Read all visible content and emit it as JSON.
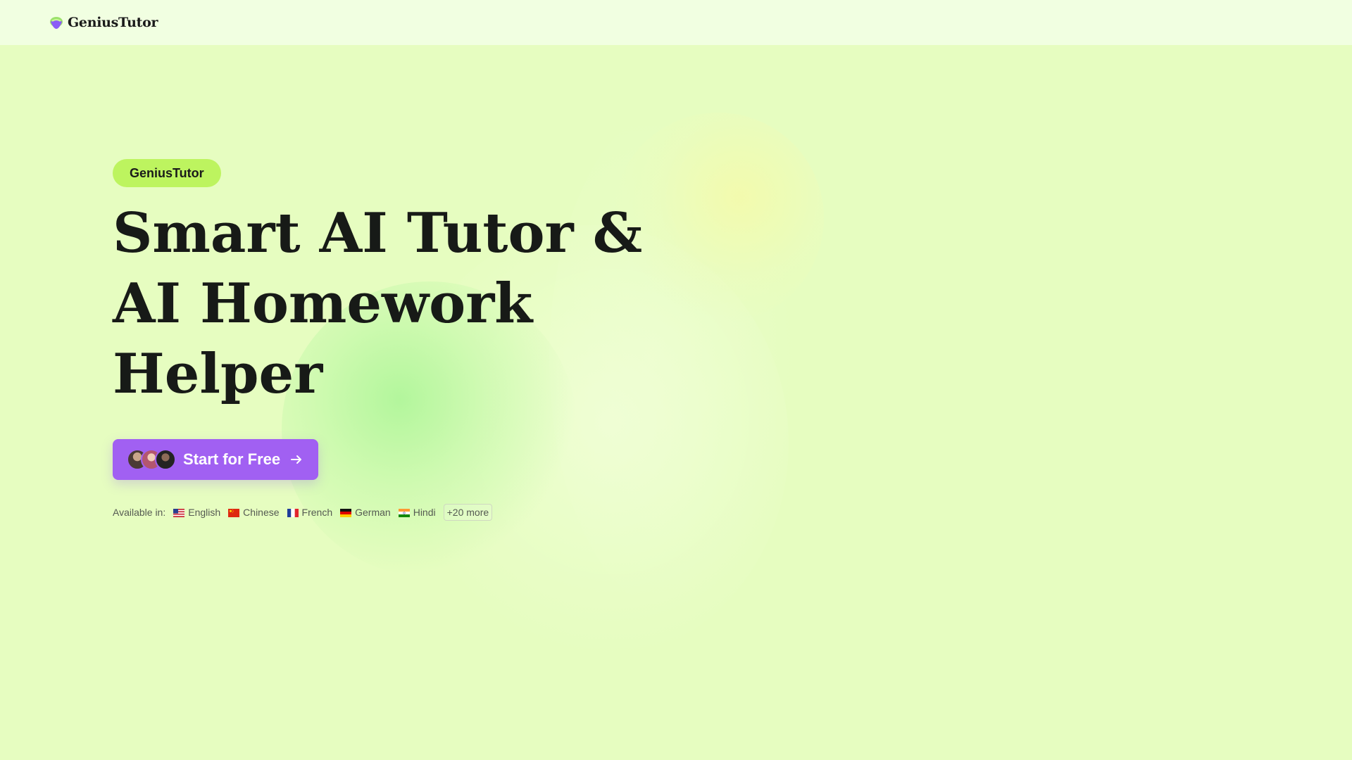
{
  "header": {
    "brand": "GeniusTutor",
    "logo_icon": "geniustutor-logo-icon"
  },
  "hero": {
    "badge": "GeniusTutor",
    "headline_lines": [
      "Smart AI Tutor &",
      "AI Homework",
      "Helper"
    ],
    "cta": {
      "label": "Start for Free",
      "icon": "arrow-right-icon",
      "avatars": [
        "user-avatar-1",
        "user-avatar-2",
        "user-avatar-3"
      ]
    },
    "languages": {
      "label": "Available in:",
      "items": [
        {
          "flag": "us-flag-icon",
          "name": "English"
        },
        {
          "flag": "cn-flag-icon",
          "name": "Chinese"
        },
        {
          "flag": "fr-flag-icon",
          "name": "French"
        },
        {
          "flag": "de-flag-icon",
          "name": "German"
        },
        {
          "flag": "in-flag-icon",
          "name": "Hindi"
        }
      ],
      "more": "+20 more"
    }
  },
  "colors": {
    "background": "#e6fdc0",
    "header_background": "#f1ffe1",
    "badge": "#bdf45f",
    "cta": "#a160f2",
    "text": "#171a17"
  }
}
